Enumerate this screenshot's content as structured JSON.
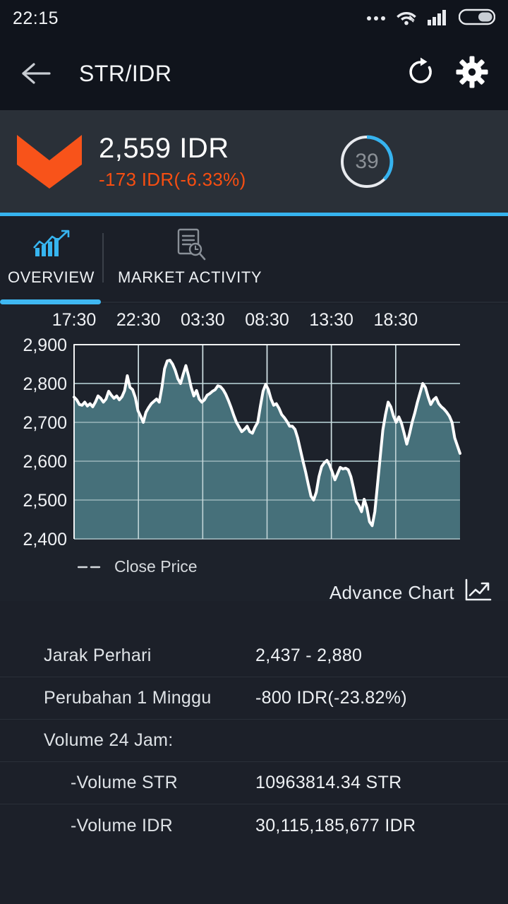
{
  "status_bar": {
    "time": "22:15",
    "icons": [
      "more-dots-icon",
      "wifi-link-icon",
      "signal-bars-icon",
      "battery-icon"
    ]
  },
  "app_bar": {
    "back_icon": "back-arrow-icon",
    "title": "STR/IDR",
    "refresh_icon": "refresh-icon",
    "settings_icon": "gear-icon"
  },
  "price_header": {
    "trend": "down",
    "trend_icon": "down-chevron-icon",
    "price": "2,559 IDR",
    "change": "-173 IDR(-6.33%)",
    "countdown": "39",
    "accent_blue": "#36b3ef",
    "down_orange": "#f74e11",
    "panel_bg": "#2a3038"
  },
  "tabs": {
    "items": [
      {
        "label": "OVERVIEW",
        "icon": "bar-chart-trend-icon",
        "active": true
      },
      {
        "label": "MARKET ACTIVITY",
        "icon": "document-search-icon",
        "active": false
      }
    ]
  },
  "chart_card": {
    "legend_label": "Close Price",
    "advance_chart_label": "Advance Chart",
    "advance_chart_icon": "line-chart-arrow-icon"
  },
  "chart_data": {
    "type": "area",
    "title": "",
    "xlabel": "",
    "ylabel": "",
    "series_name": "Close Price",
    "line_color": "#ffffff",
    "fill_color": "#46707a",
    "grid": true,
    "legend_position": "bottom-left",
    "ylim": [
      2400,
      2900
    ],
    "yticks": [
      2900,
      2800,
      2700,
      2600,
      2500,
      2400
    ],
    "ytick_labels": [
      "2,900",
      "2,800",
      "2,700",
      "2,600",
      "2,500",
      "2,400"
    ],
    "xticks": [
      "17:30",
      "22:30",
      "03:30",
      "08:30",
      "13:30",
      "18:30"
    ],
    "x": [
      0,
      1,
      2,
      3,
      4,
      5,
      6,
      7,
      8,
      9,
      10,
      11,
      12,
      13,
      14,
      15,
      16,
      17,
      18,
      19,
      20,
      21,
      22,
      23,
      24,
      25,
      26,
      27,
      28,
      29,
      30,
      31,
      32,
      33,
      34,
      35,
      36,
      37,
      38,
      39,
      40,
      41,
      42,
      43,
      44,
      45,
      46,
      47,
      48,
      49,
      50,
      51,
      52,
      53,
      54,
      55,
      56,
      57,
      58,
      59,
      60,
      61,
      62,
      63,
      64,
      65,
      66,
      67,
      68,
      69,
      70,
      71,
      72,
      73,
      74,
      75,
      76,
      77,
      78,
      79,
      80,
      81,
      82,
      83,
      84,
      85,
      86,
      87,
      88,
      89,
      90,
      91,
      92,
      93,
      94,
      95,
      96,
      97,
      98,
      99,
      100,
      101,
      102,
      103,
      104,
      105,
      106,
      107,
      108,
      109,
      110,
      111,
      112,
      113,
      114,
      115,
      116,
      117,
      118,
      119,
      120,
      121,
      122,
      123,
      124,
      125,
      126,
      127,
      128,
      129,
      130,
      131,
      132,
      133,
      134,
      135,
      136,
      137,
      138,
      139,
      140,
      141,
      142,
      143,
      144,
      145
    ],
    "values": [
      2765,
      2758,
      2746,
      2744,
      2752,
      2742,
      2748,
      2740,
      2752,
      2768,
      2762,
      2752,
      2760,
      2780,
      2770,
      2762,
      2768,
      2758,
      2766,
      2782,
      2820,
      2790,
      2784,
      2764,
      2730,
      2716,
      2700,
      2726,
      2738,
      2748,
      2754,
      2760,
      2752,
      2790,
      2838,
      2858,
      2860,
      2850,
      2834,
      2812,
      2800,
      2824,
      2846,
      2820,
      2790,
      2768,
      2782,
      2760,
      2752,
      2758,
      2770,
      2774,
      2780,
      2784,
      2794,
      2792,
      2784,
      2772,
      2756,
      2738,
      2718,
      2700,
      2688,
      2676,
      2682,
      2690,
      2676,
      2672,
      2688,
      2700,
      2742,
      2780,
      2798,
      2784,
      2760,
      2744,
      2748,
      2736,
      2720,
      2712,
      2702,
      2690,
      2690,
      2682,
      2660,
      2630,
      2600,
      2572,
      2540,
      2510,
      2500,
      2520,
      2560,
      2586,
      2596,
      2602,
      2590,
      2572,
      2552,
      2568,
      2584,
      2580,
      2582,
      2578,
      2560,
      2530,
      2496,
      2486,
      2470,
      2502,
      2480,
      2444,
      2434,
      2470,
      2540,
      2610,
      2680,
      2720,
      2752,
      2740,
      2716,
      2700,
      2714,
      2698,
      2672,
      2644,
      2670,
      2700,
      2724,
      2752,
      2776,
      2800,
      2790,
      2766,
      2746,
      2758,
      2764,
      2748,
      2740,
      2734,
      2726,
      2716,
      2700,
      2660,
      2640,
      2620
    ]
  },
  "info_table": {
    "rows": [
      {
        "label": "Jarak Perhari",
        "value": "2,437 - 2,880",
        "indent": false
      },
      {
        "label": "Perubahan 1 Minggu",
        "value": "-800 IDR(-23.82%)",
        "indent": false
      },
      {
        "label": "Volume 24 Jam:",
        "value": "",
        "indent": false
      },
      {
        "label": "-Volume STR",
        "value": "10963814.34 STR",
        "indent": true
      },
      {
        "label": "-Volume IDR",
        "value": "30,115,185,677 IDR",
        "indent": true
      }
    ]
  }
}
